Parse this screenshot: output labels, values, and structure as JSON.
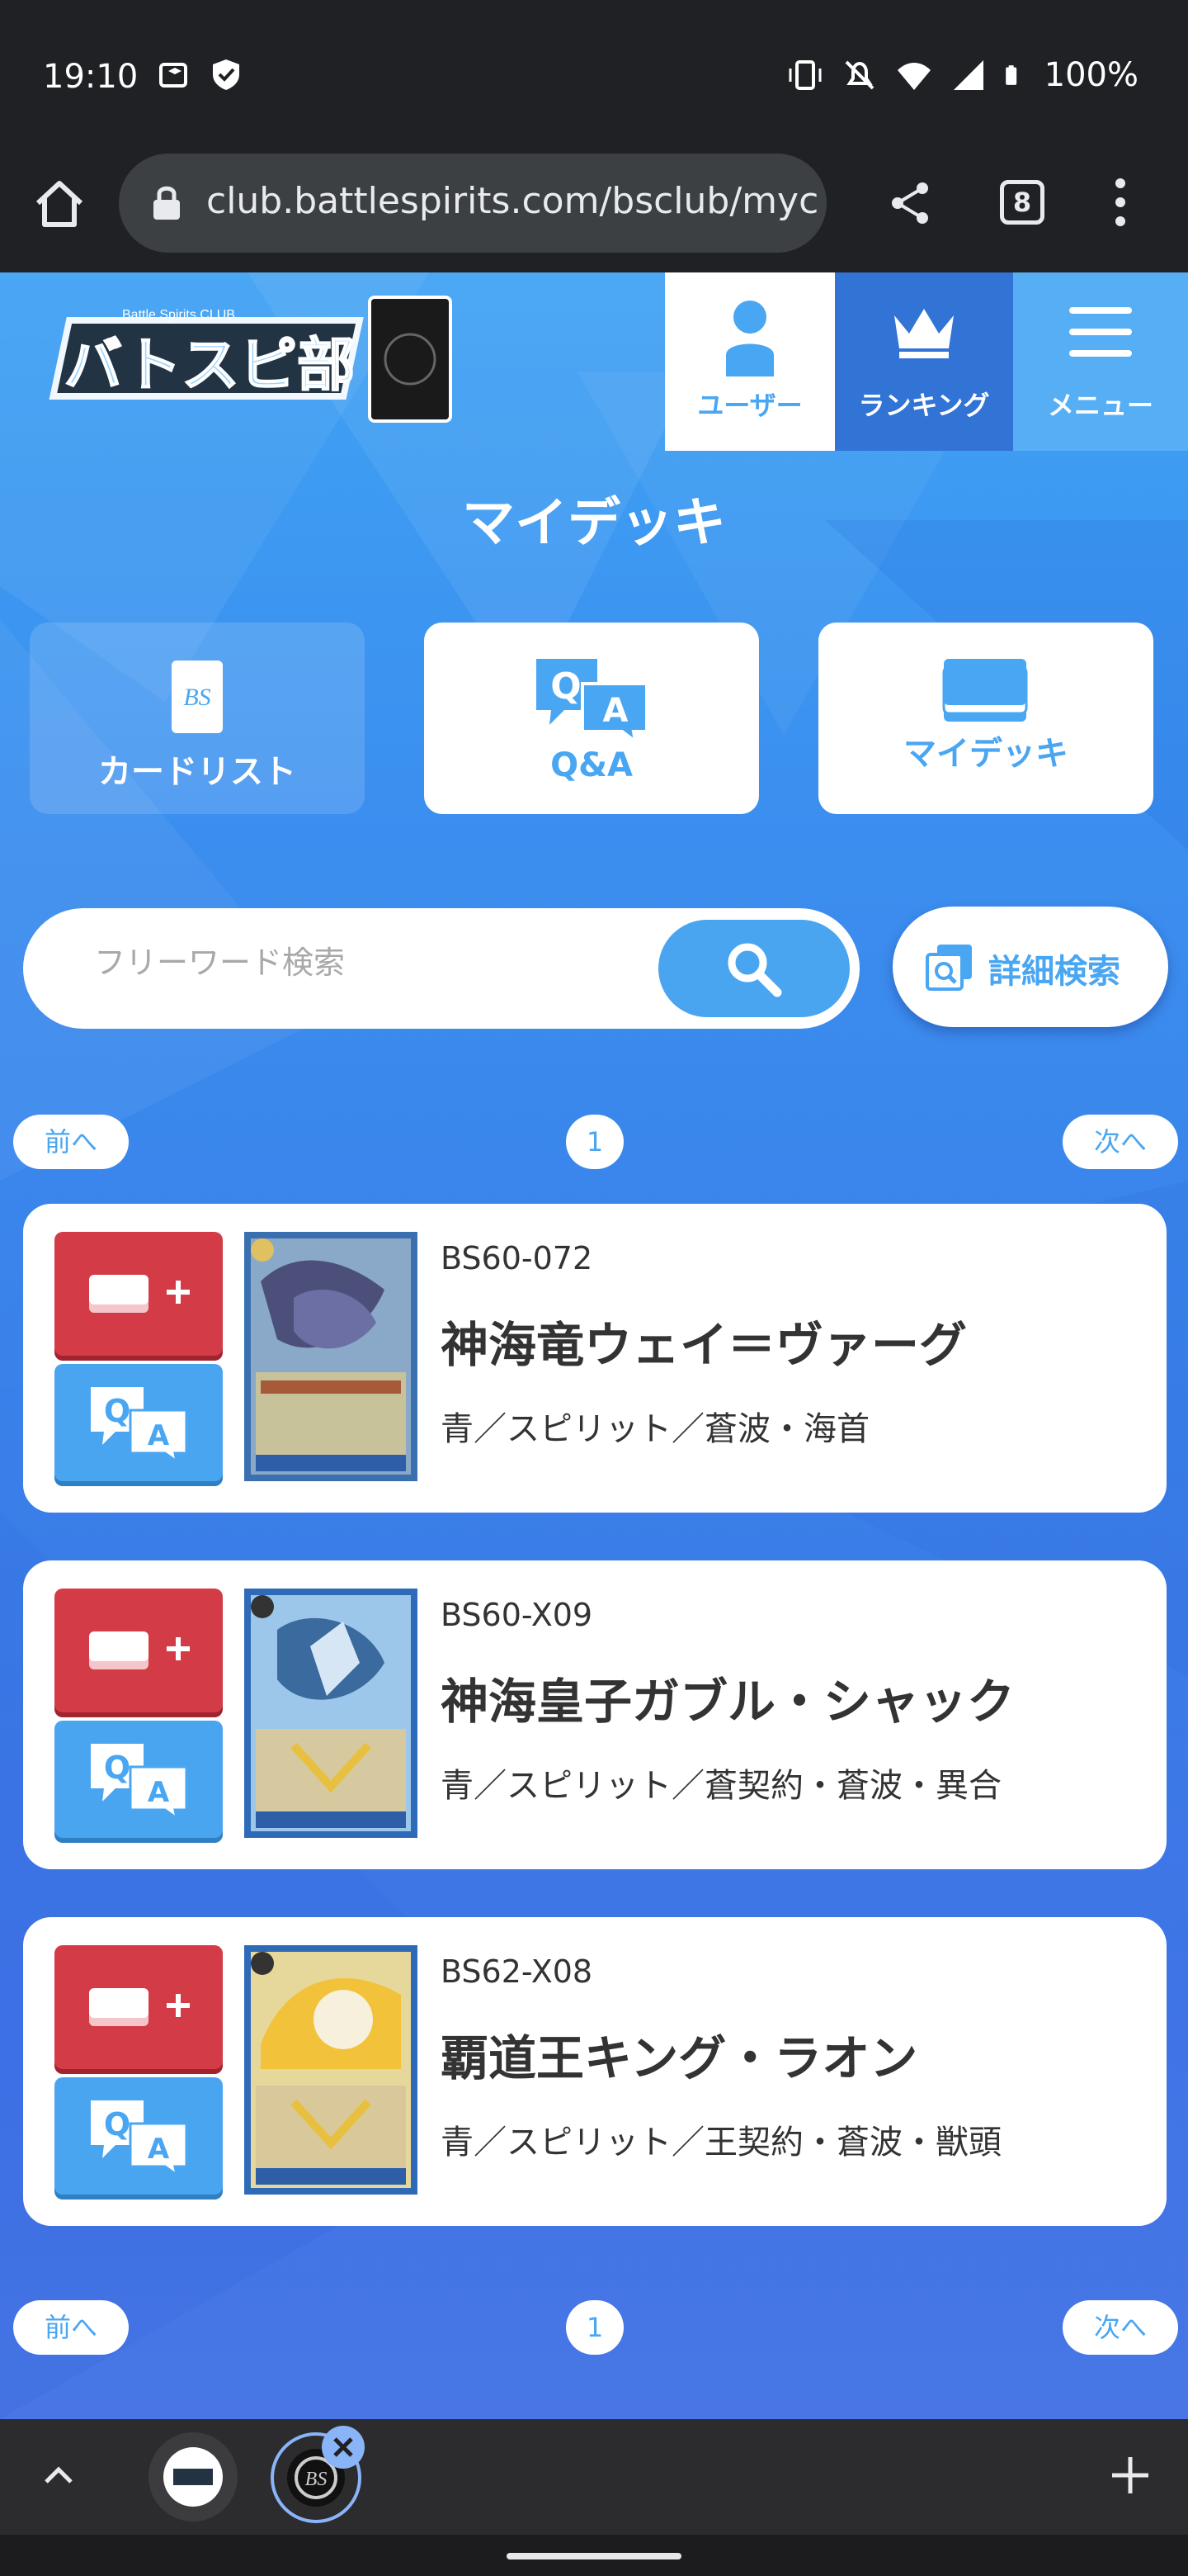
{
  "status_bar": {
    "time": "19:10",
    "battery": "100%",
    "icons": [
      "nfc-icon",
      "shield-icon",
      "vibrate-icon",
      "mute-icon",
      "wifi-icon",
      "signal-icon",
      "battery-icon"
    ]
  },
  "browser": {
    "url": "club.battlespirits.com/bsclub/myc",
    "tab_count": "8"
  },
  "header": {
    "logo_text": "バトスピ部",
    "logo_sub": "Battle Spirits CLUB",
    "nav": [
      {
        "label": "ユーザー",
        "icon": "user-icon"
      },
      {
        "label": "ランキング",
        "icon": "crown-icon"
      },
      {
        "label": "メニュー",
        "icon": "hamburger-icon"
      }
    ]
  },
  "page_title": "マイデッキ",
  "tiles": [
    {
      "label": "カードリスト",
      "icon": "bs-card-icon"
    },
    {
      "label": "Q&A",
      "icon": "qa-bubbles-icon"
    },
    {
      "label": "マイデッキ",
      "icon": "deck-icon"
    }
  ],
  "search": {
    "placeholder": "フリーワード検索",
    "advanced_label": "詳細検索"
  },
  "pager": {
    "prev": "前へ",
    "page": "1",
    "next": "次へ"
  },
  "cards": [
    {
      "code": "BS60-072",
      "name": "神海竜ウェイ＝ヴァーグ",
      "attributes": "青／スピリット／蒼波・海首"
    },
    {
      "code": "BS60-X09",
      "name": "神海皇子ガブル・シャック",
      "attributes": "青／スピリット／蒼契約・蒼波・異合"
    },
    {
      "code": "BS62-X08",
      "name": "覇道王キング・ラオン",
      "attributes": "青／スピリット／王契約・蒼波・獣頭"
    }
  ],
  "colors": {
    "accent_blue": "#49a6f2",
    "deck_red": "#d33c47",
    "page_blue": "#3b8fef"
  }
}
